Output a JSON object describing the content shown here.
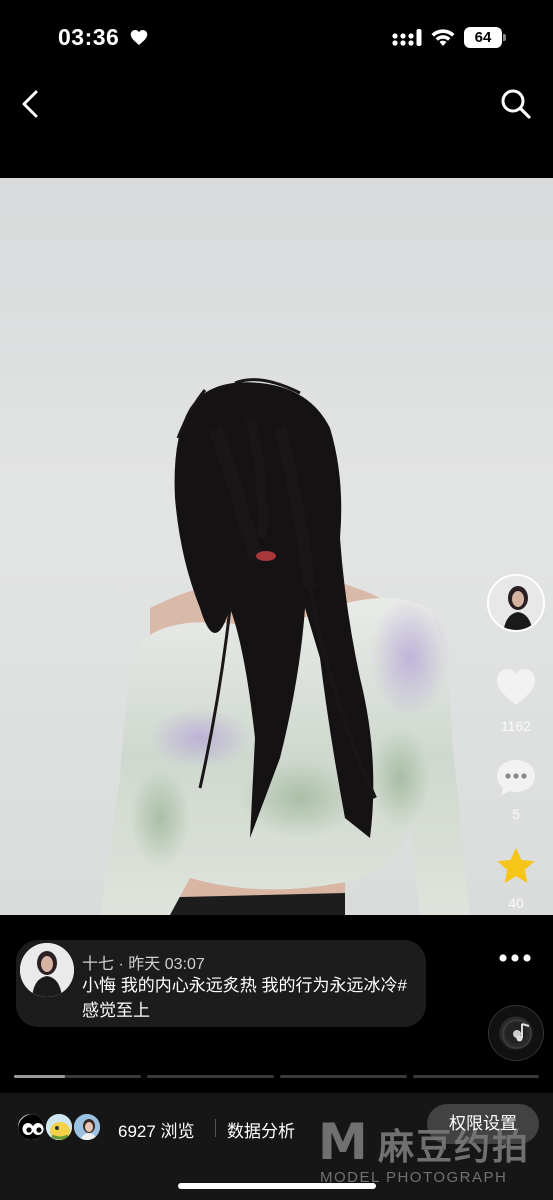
{
  "status_bar": {
    "time": "03:36",
    "battery": "64"
  },
  "nav": {
    "back_icon": "chevron-left-icon",
    "search_icon": "search-icon"
  },
  "post": {
    "author_name": "十七",
    "separator": "·",
    "timestamp": "昨天 03:07",
    "caption": "小悔 我的内心永远炙热 我的行为永远冰冷#感觉至上"
  },
  "actions": {
    "likes": "1162",
    "comments": "5",
    "favorites": "40"
  },
  "progress": {
    "segments": 4,
    "current": 1,
    "current_fill": 0.4
  },
  "bottom_bar": {
    "views": "6927 浏览",
    "analysis": "数据分析",
    "permission_button": "权限设置"
  },
  "watermark": {
    "logo_letter": "M",
    "brand_cn": "麻豆约拍",
    "brand_en": "MODEL PHOTOGRAPH"
  },
  "colors": {
    "background": "#000000",
    "card": "#1c1c1c",
    "star": "#f5c518",
    "bottom_bar": "#161616"
  }
}
